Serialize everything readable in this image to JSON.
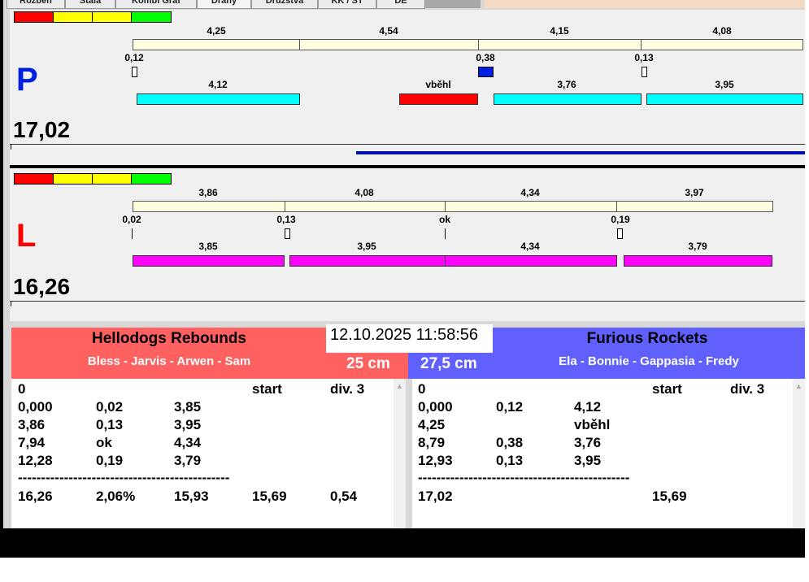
{
  "tabs": [
    "Rozběh",
    "Stala",
    "Kombi Graf",
    "Dráhy",
    "Družstva",
    "KK / ST",
    "DE"
  ],
  "lanes": [
    {
      "letter": "P",
      "total": "17,02",
      "segments": [
        "4,25",
        "4,54",
        "4,15",
        "4,08"
      ],
      "reactions": [
        "0,12",
        "0,38",
        "0,13"
      ],
      "runs": [
        "4,12",
        "vběhl",
        "3,76",
        "3,95"
      ]
    },
    {
      "letter": "L",
      "total": "16,26",
      "segments": [
        "3,86",
        "4,08",
        "4,34",
        "3,97"
      ],
      "reactions": [
        "0,02",
        "0,13",
        "ok",
        "0,19"
      ],
      "runs": [
        "3,85",
        "3,95",
        "4,34",
        "3,79"
      ]
    }
  ],
  "datetime": "12.10.2025 11:58:56",
  "left_team": {
    "name": "Hellodogs Rebounds",
    "dogs": "Bless - Jarvis - Arwen - Sam",
    "height": "25 cm",
    "color": "#ff6060",
    "header": [
      "0",
      "",
      "",
      "start",
      "div.  3"
    ],
    "rows": [
      [
        "0,000",
        "0,02",
        "3,85"
      ],
      [
        "3,86",
        "0,13",
        "3,95"
      ],
      [
        "7,94",
        "ok",
        "4,34"
      ],
      [
        "12,28",
        "0,19",
        "3,79"
      ]
    ],
    "separator": "----------------------------------------------",
    "totals": [
      "16,26",
      "2,06%",
      "15,93",
      "15,69",
      "0,54"
    ]
  },
  "right_team": {
    "name": "Furious Rockets",
    "dogs": "Ela - Bonnie - Gappasia - Fredy",
    "height": "27,5 cm",
    "color": "#6060ff",
    "header": [
      "0",
      "",
      "",
      "start",
      "div.  3"
    ],
    "rows": [
      [
        "0,000",
        "0,12",
        "4,12"
      ],
      [
        "4,25",
        "",
        "vběhl"
      ],
      [
        "8,79",
        "0,38",
        "3,76"
      ],
      [
        "12,93",
        "0,13",
        "3,95"
      ]
    ],
    "separator": "----------------------------------------------",
    "totals": [
      "17,02",
      "",
      "",
      "15,69",
      ""
    ]
  }
}
